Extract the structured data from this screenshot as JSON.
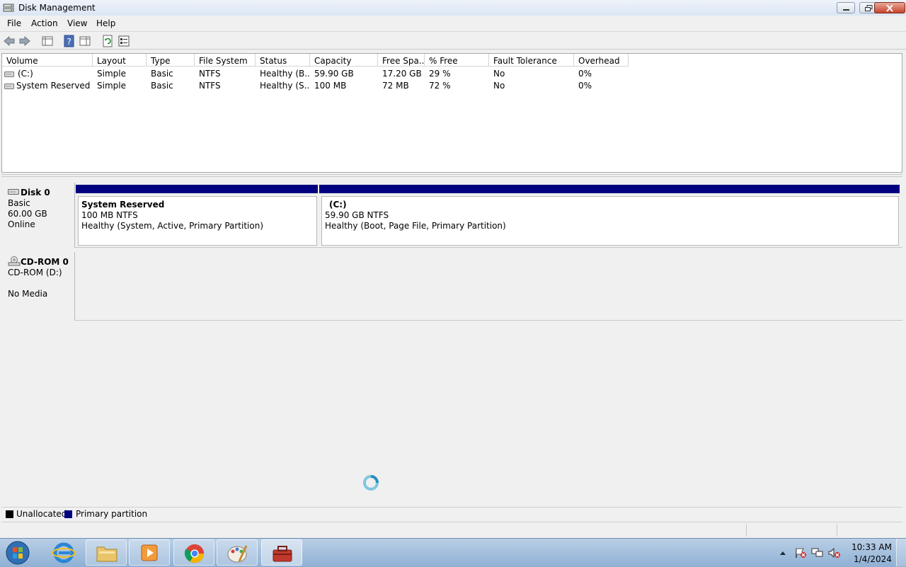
{
  "window": {
    "title": "Disk Management"
  },
  "menu": [
    "File",
    "Action",
    "View",
    "Help"
  ],
  "columns": [
    "Volume",
    "Layout",
    "Type",
    "File System",
    "Status",
    "Capacity",
    "Free Spa...",
    "% Free",
    "Fault Tolerance",
    "Overhead"
  ],
  "volumes": [
    [
      "(C:)",
      "Simple",
      "Basic",
      "NTFS",
      "Healthy (B...",
      "59.90 GB",
      "17.20 GB",
      "29 %",
      "No",
      "0%"
    ],
    [
      "System Reserved",
      "Simple",
      "Basic",
      "NTFS",
      "Healthy (S...",
      "100 MB",
      "72 MB",
      "72 %",
      "No",
      "0%"
    ]
  ],
  "disk0": {
    "name": "Disk 0",
    "type": "Basic",
    "size": "60.00 GB",
    "state": "Online",
    "partitions": [
      {
        "name": "System Reserved",
        "size": "100 MB NTFS",
        "status": "Healthy (System, Active, Primary Partition)"
      },
      {
        "name": "(C:)",
        "size": "59.90 GB NTFS",
        "status": "Healthy (Boot, Page File, Primary Partition)"
      }
    ]
  },
  "cdrom0": {
    "name": "CD-ROM 0",
    "drive": "CD-ROM (D:)",
    "media": "No Media"
  },
  "legend": {
    "unallocated": "Unallocated",
    "primary": "Primary partition",
    "unallocated_color": "#000000",
    "primary_color": "#000080"
  },
  "taskbar": {
    "time": "10:33 AM",
    "date": "1/4/2024"
  }
}
